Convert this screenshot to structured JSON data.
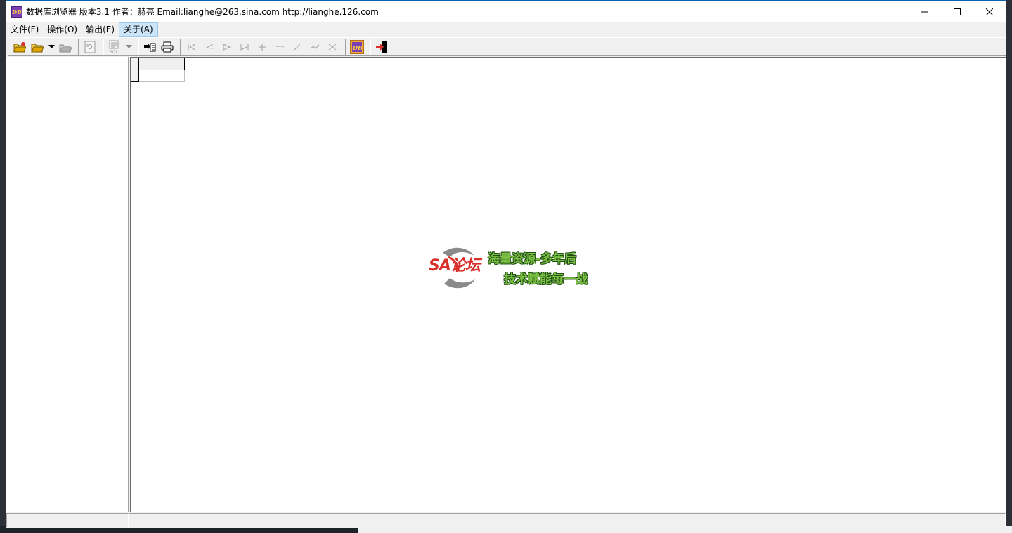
{
  "window": {
    "title": "数据库浏览器 版本3.1 作者：赫亮  Email:lianghe@263.sina.com http://lianghe.126.com",
    "icon": "app-logo-icon",
    "icon_text": "DB",
    "controls": [
      "minimize-icon",
      "maximize-icon",
      "close-icon"
    ]
  },
  "menu": {
    "items": [
      {
        "label": "文件(F)"
      },
      {
        "label": "操作(O)"
      },
      {
        "label": "输出(E)"
      },
      {
        "label": "关于(A)"
      }
    ],
    "active_index": 3
  },
  "toolbar": {
    "buttons": [
      "open-database-icon",
      "open-folder-icon",
      "dropdown-arrow-icon",
      "save-icon",
      "refresh-icon",
      "sql-query-icon",
      "dropdown-arrow-icon",
      "export-icon",
      "print-icon",
      "first-record-icon",
      "prior-record-icon",
      "next-record-icon",
      "last-record-icon",
      "insert-record-icon",
      "delete-record-icon",
      "edit-record-icon",
      "post-record-icon",
      "cancel-record-icon",
      "about-icon",
      "exit-icon"
    ]
  },
  "watermark": {
    "logo": "SA论坛",
    "line1": "海量资源-多年后",
    "line2": "技术赋能每一战"
  },
  "colors": {
    "title_bg": "#ffffff",
    "window_border": "#0a64ad",
    "menu_active": "#cce4f7",
    "chrome": "#f0f0f0",
    "accent_purple": "#7a3fb3",
    "watermark_green": "#7bc043",
    "watermark_red": "#d9302c"
  }
}
